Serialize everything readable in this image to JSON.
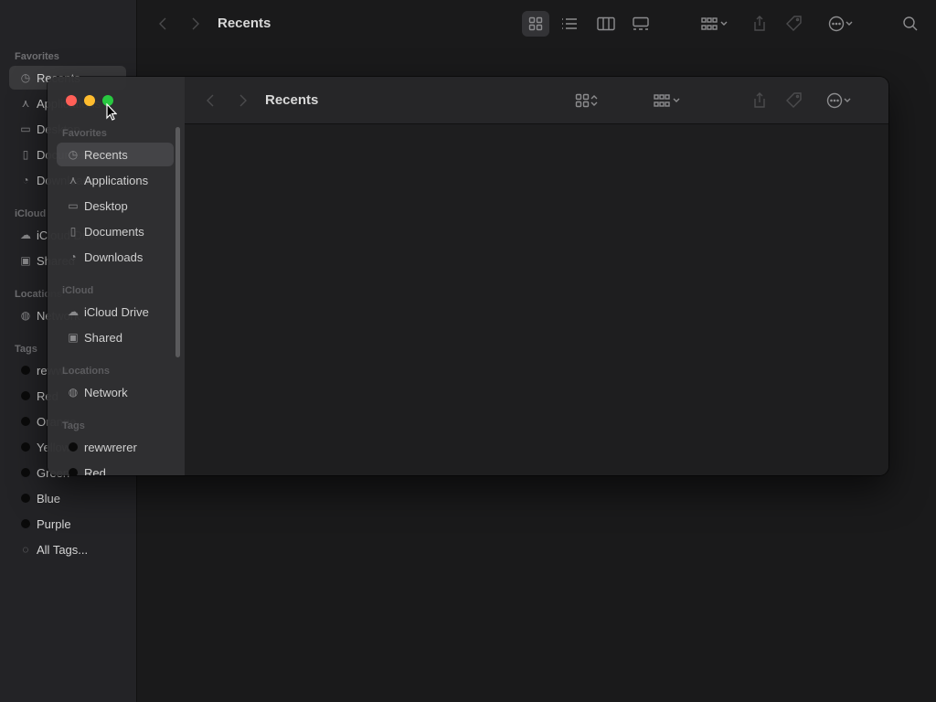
{
  "background_window": {
    "title": "Recents",
    "sidebar": {
      "favorites_header": "Favorites",
      "favorites": [
        {
          "label": "Recents",
          "icon": "clock-icon"
        },
        {
          "label": "Applications",
          "icon": "applications-icon"
        },
        {
          "label": "Desktop",
          "icon": "desktop-icon"
        },
        {
          "label": "Documents",
          "icon": "document-icon"
        },
        {
          "label": "Downloads",
          "icon": "download-icon"
        }
      ],
      "icloud_header": "iCloud",
      "icloud": [
        {
          "label": "iCloud Drive",
          "icon": "cloud-icon"
        },
        {
          "label": "Shared",
          "icon": "shared-folder-icon"
        }
      ],
      "locations_header": "Locations",
      "locations": [
        {
          "label": "Network",
          "icon": "globe-icon"
        }
      ],
      "tags_header": "Tags",
      "tags": [
        {
          "label": "rewwrerer"
        },
        {
          "label": "Red"
        },
        {
          "label": "Orange"
        },
        {
          "label": "Yellow"
        },
        {
          "label": "Green"
        },
        {
          "label": "Blue"
        },
        {
          "label": "Purple"
        },
        {
          "label": "All Tags...",
          "icon": "all-tags-icon"
        }
      ]
    }
  },
  "front_window": {
    "title": "Recents",
    "sidebar": {
      "favorites_header": "Favorites",
      "favorites": [
        {
          "label": "Recents"
        },
        {
          "label": "Applications"
        },
        {
          "label": "Desktop"
        },
        {
          "label": "Documents"
        },
        {
          "label": "Downloads"
        }
      ],
      "icloud_header": "iCloud",
      "icloud": [
        {
          "label": "iCloud Drive"
        },
        {
          "label": "Shared"
        }
      ],
      "locations_header": "Locations",
      "locations": [
        {
          "label": "Network"
        }
      ],
      "tags_header": "Tags",
      "tags": [
        {
          "label": "rewwrerer"
        },
        {
          "label": "Red"
        }
      ]
    }
  },
  "colors": {
    "close": "#ff5f57",
    "minimize": "#febc2e",
    "zoom": "#28c840",
    "tag_dot": "#0a0a0a",
    "background": "#1b1b1d"
  }
}
